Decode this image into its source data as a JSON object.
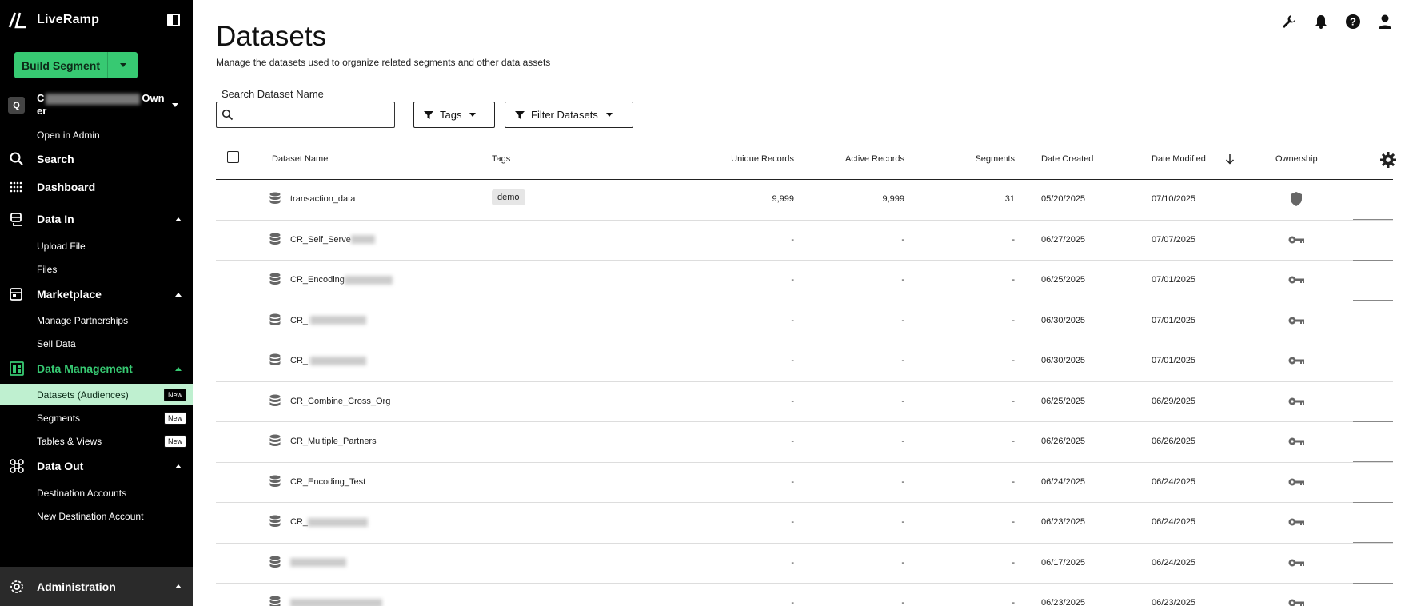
{
  "app": {
    "brand_name": "LiveRamp",
    "build_segment_label": "Build Segment",
    "org": {
      "badge": "Q",
      "name_prefix": "C",
      "name_suffix": "Own",
      "name_wrap": "er",
      "open_in_admin": "Open in Admin"
    }
  },
  "sidebar": {
    "search": "Search",
    "dashboard": "Dashboard",
    "data_in": {
      "label": "Data In",
      "items": [
        "Upload File",
        "Files"
      ]
    },
    "marketplace": {
      "label": "Marketplace",
      "items": [
        "Manage Partnerships",
        "Sell Data"
      ]
    },
    "data_management": {
      "label": "Data Management",
      "items": [
        {
          "label": "Datasets (Audiences)",
          "badge": "New",
          "active": true
        },
        {
          "label": "Segments",
          "badge": "New",
          "active": false
        },
        {
          "label": "Tables & Views",
          "badge": "New",
          "active": false
        }
      ]
    },
    "data_out": {
      "label": "Data Out",
      "items": [
        "Destination Accounts",
        "New Destination Account"
      ]
    },
    "administration": "Administration"
  },
  "page": {
    "title": "Datasets",
    "subtitle": "Manage the datasets used to organize related segments and other data assets",
    "search_label": "Search Dataset Name",
    "search_value": "",
    "tags_button": "Tags",
    "filter_button": "Filter Datasets"
  },
  "table": {
    "columns": {
      "name": "Dataset Name",
      "tags": "Tags",
      "unique": "Unique Records",
      "active": "Active Records",
      "segments": "Segments",
      "created": "Date Created",
      "modified": "Date Modified",
      "ownership": "Ownership"
    },
    "rows": [
      {
        "name": "transaction_data",
        "tag": "demo",
        "unique": "9,999",
        "active": "9,999",
        "segments": "31",
        "created": "05/20/2025",
        "modified": "07/10/2025",
        "ownership": "shield"
      },
      {
        "name": "CR_Self_Serve",
        "tag": "",
        "unique": "-",
        "active": "-",
        "segments": "-",
        "created": "06/27/2025",
        "modified": "07/07/2025",
        "ownership": "key"
      },
      {
        "name": "CR_Encoding",
        "tag": "",
        "unique": "-",
        "active": "-",
        "segments": "-",
        "created": "06/25/2025",
        "modified": "07/01/2025",
        "ownership": "key"
      },
      {
        "name": "CR_I",
        "tag": "",
        "unique": "-",
        "active": "-",
        "segments": "-",
        "created": "06/30/2025",
        "modified": "07/01/2025",
        "ownership": "key"
      },
      {
        "name": "CR_I",
        "tag": "",
        "unique": "-",
        "active": "-",
        "segments": "-",
        "created": "06/30/2025",
        "modified": "07/01/2025",
        "ownership": "key"
      },
      {
        "name": "CR_Combine_Cross_Org",
        "tag": "",
        "unique": "-",
        "active": "-",
        "segments": "-",
        "created": "06/25/2025",
        "modified": "06/29/2025",
        "ownership": "key"
      },
      {
        "name": "CR_Multiple_Partners",
        "tag": "",
        "unique": "-",
        "active": "-",
        "segments": "-",
        "created": "06/26/2025",
        "modified": "06/26/2025",
        "ownership": "key"
      },
      {
        "name": "CR_Encoding_Test",
        "tag": "",
        "unique": "-",
        "active": "-",
        "segments": "-",
        "created": "06/24/2025",
        "modified": "06/24/2025",
        "ownership": "key"
      },
      {
        "name": "CR_",
        "tag": "",
        "unique": "-",
        "active": "-",
        "segments": "-",
        "created": "06/23/2025",
        "modified": "06/24/2025",
        "ownership": "key"
      },
      {
        "name": "",
        "tag": "",
        "unique": "-",
        "active": "-",
        "segments": "-",
        "created": "06/17/2025",
        "modified": "06/24/2025",
        "ownership": "key"
      },
      {
        "name": "",
        "tag": "",
        "unique": "-",
        "active": "-",
        "segments": "-",
        "created": "06/23/2025",
        "modified": "06/23/2025",
        "ownership": "key"
      }
    ]
  },
  "colors": {
    "accent": "#37c972",
    "sidebar_bg": "#000000",
    "active_item_bg": "#bff0d0"
  }
}
